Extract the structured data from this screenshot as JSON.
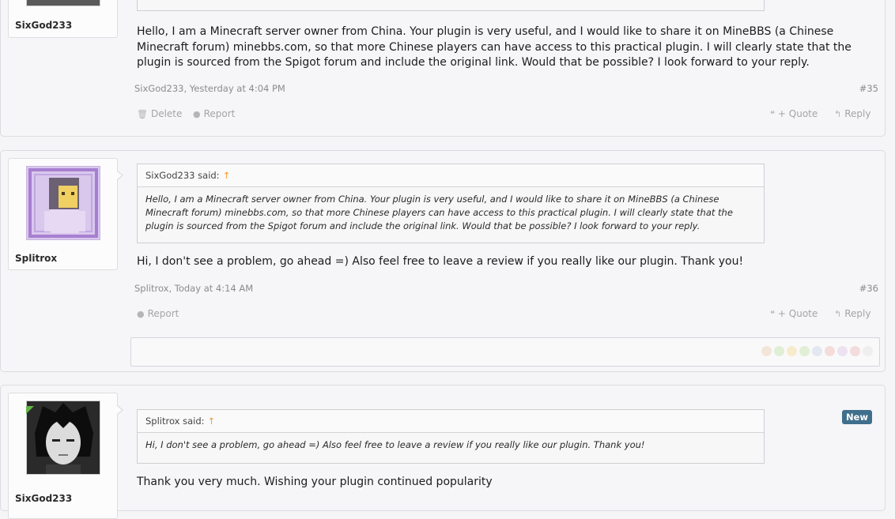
{
  "posts": [
    {
      "username": "SixGod233",
      "message": "Hello, I am a Minecraft server owner from China. Your plugin is very useful, and I would like to share it on MineBBS (a Chinese Minecraft forum) minebbs.com, so that more Chinese players can have access to this practical plugin. I will clearly state that the plugin is sourced from the Spigot forum and include the original link. Would that be possible? I look forward to your reply.",
      "meta": "SixGod233, Yesterday at 4:04 PM",
      "number": "#35",
      "delete_label": "Delete",
      "report_label": "Report",
      "quote_label": "+ Quote",
      "reply_label": "Reply"
    },
    {
      "username": "Splitrox",
      "quote_author": "SixGod233 said:",
      "quote_text": "Hello, I am a Minecraft server owner from China. Your plugin is very useful, and I would like to share it on MineBBS (a Chinese Minecraft forum) minebbs.com, so that more Chinese players can have access to this practical plugin. I will clearly state that the plugin is sourced from the Spigot forum and include the original link. Would that be possible? I look forward to your reply.",
      "message": "Hi, I don't see a problem, go ahead =) Also feel free to leave a review if you really like our plugin. Thank you!",
      "meta": "Splitrox, Today at 4:14 AM",
      "number": "#36",
      "report_label": "Report",
      "quote_label": "+ Quote",
      "reply_label": "Reply"
    },
    {
      "username": "SixGod233",
      "badge": "New",
      "quote_author": "Splitrox said:",
      "quote_text": "Hi, I don't see a problem, go ahead =) Also feel free to leave a review if you really like our plugin. Thank you!",
      "message": "Thank you very much. Wishing your plugin continued popularity"
    }
  ],
  "icons": {
    "quote_arrow": "↑",
    "delete": "trash-icon",
    "report": "alert-circle-icon",
    "quote": "quote-marks-icon",
    "reply": "reply-arrow-icon"
  },
  "colors": {
    "badge_bg": "#3f6f8c",
    "quote_arrow": "#f39a33",
    "online": "#63b348"
  }
}
